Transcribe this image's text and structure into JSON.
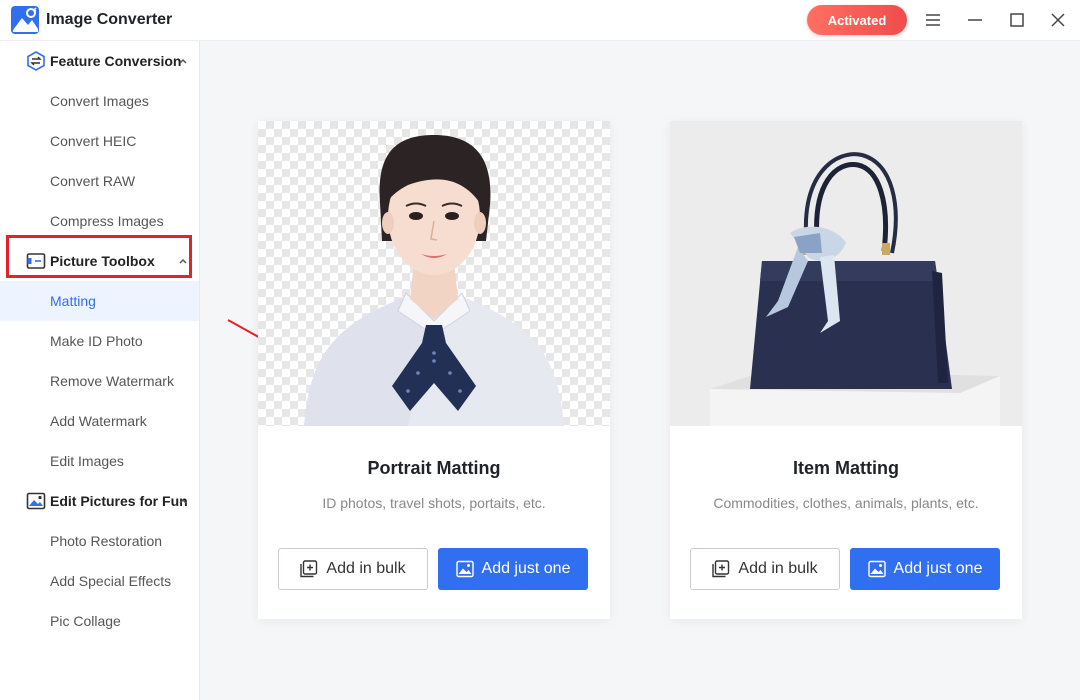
{
  "app": {
    "title": "Image Converter",
    "activated_label": "Activated",
    "accent_color": "#2f6ff0",
    "activated_color": "#f04c4c"
  },
  "window_controls": {
    "menu_icon": "menu-icon",
    "minimize_icon": "minimize-icon",
    "maximize_icon": "maximize-icon",
    "close_icon": "close-icon"
  },
  "sidebar": {
    "groups": [
      {
        "label": "Feature Conversion",
        "icon": "convert-icon",
        "items": [
          "Convert Images",
          "Convert HEIC",
          "Convert RAW",
          "Compress Images"
        ]
      },
      {
        "label": "Picture Toolbox",
        "icon": "toolbox-icon",
        "items": [
          "Matting",
          "Make ID Photo",
          "Remove Watermark",
          "Add Watermark",
          "Edit Images"
        ]
      },
      {
        "label": "Edit Pictures for Fun",
        "icon": "picture-icon",
        "items": [
          "Photo Restoration",
          "Add Special Effects",
          "Pic Collage"
        ]
      }
    ],
    "active_item": "Matting",
    "highlight_color": "#e3232b"
  },
  "cards": [
    {
      "title": "Portrait Matting",
      "subtitle": "ID photos, travel shots, portaits, etc.",
      "bulk_label": "Add in bulk",
      "one_label": "Add just one",
      "preview": "portrait-image"
    },
    {
      "title": "Item Matting",
      "subtitle": "Commodities, clothes, animals, plants, etc.",
      "bulk_label": "Add in bulk",
      "one_label": "Add just one",
      "preview": "handbag-image"
    }
  ]
}
